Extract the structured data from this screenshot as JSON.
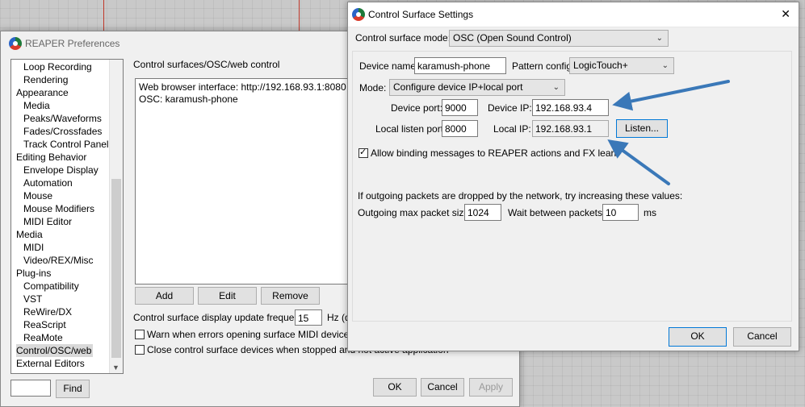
{
  "prefs": {
    "title": "REAPER Preferences",
    "section_header": "Control surfaces/OSC/web control",
    "tree": [
      {
        "label": "Loop Recording",
        "indent": 1
      },
      {
        "label": "Rendering",
        "indent": 1
      },
      {
        "label": "Appearance",
        "indent": 0
      },
      {
        "label": "Media",
        "indent": 1
      },
      {
        "label": "Peaks/Waveforms",
        "indent": 1
      },
      {
        "label": "Fades/Crossfades",
        "indent": 1
      },
      {
        "label": "Track Control Panels",
        "indent": 1
      },
      {
        "label": "Editing Behavior",
        "indent": 0
      },
      {
        "label": "Envelope Display",
        "indent": 1
      },
      {
        "label": "Automation",
        "indent": 1
      },
      {
        "label": "Mouse",
        "indent": 1
      },
      {
        "label": "Mouse Modifiers",
        "indent": 1
      },
      {
        "label": "MIDI Editor",
        "indent": 1
      },
      {
        "label": "Media",
        "indent": 0
      },
      {
        "label": "MIDI",
        "indent": 1
      },
      {
        "label": "Video/REX/Misc",
        "indent": 1
      },
      {
        "label": "Plug-ins",
        "indent": 0
      },
      {
        "label": "Compatibility",
        "indent": 1
      },
      {
        "label": "VST",
        "indent": 1
      },
      {
        "label": "ReWire/DX",
        "indent": 1
      },
      {
        "label": "ReaScript",
        "indent": 1
      },
      {
        "label": "ReaMote",
        "indent": 1
      },
      {
        "label": "Control/OSC/web",
        "indent": 0,
        "selected": true
      },
      {
        "label": "External Editors",
        "indent": 0
      }
    ],
    "surfaces": [
      "Web browser interface: http://192.168.93.1:8080",
      "OSC: karamush-phone"
    ],
    "add_label": "Add",
    "edit_label": "Edit",
    "remove_label": "Remove",
    "update_freq_label": "Control surface display update frequency:",
    "update_freq_value": "15",
    "update_freq_unit": "Hz (d",
    "warn_label": "Warn when errors opening surface MIDI devices",
    "warn_checked": false,
    "close_label": "Close control surface devices when stopped and not active application",
    "close_checked": false,
    "find_value": "",
    "find_label": "Find",
    "ok_label": "OK",
    "cancel_label": "Cancel",
    "apply_label": "Apply"
  },
  "dialog": {
    "title": "Control Surface Settings",
    "close_glyph": "✕",
    "mode_label": "Control surface mode:",
    "mode_value": "OSC (Open Sound Control)",
    "device_name_label": "Device name:",
    "device_name_value": "karamush-phone",
    "pattern_label": "Pattern config:",
    "pattern_value": "LogicTouch+",
    "mode2_label": "Mode:",
    "mode2_value": "Configure device IP+local port",
    "device_port_label": "Device port:",
    "device_port_value": "9000",
    "device_ip_label": "Device IP:",
    "device_ip_value": "192.168.93.4",
    "listen_port_label": "Local listen port:",
    "listen_port_value": "8000",
    "local_ip_label": "Local IP:",
    "local_ip_value": "192.168.93.1",
    "listen_label": "Listen...",
    "allow_label": "Allow binding messages to REAPER actions and FX learn",
    "allow_checked": true,
    "packets_note": "If outgoing packets are dropped by the network, try increasing these values:",
    "max_packet_label": "Outgoing max packet size:",
    "max_packet_value": "1024",
    "wait_label": "Wait between packets:",
    "wait_value": "10",
    "wait_unit": "ms",
    "ok_label": "OK",
    "cancel_label": "Cancel"
  },
  "annotations": {
    "arrow_color": "#3a78b8",
    "arrows": [
      "arrow-to-device-ip",
      "arrow-to-local-ip"
    ]
  }
}
